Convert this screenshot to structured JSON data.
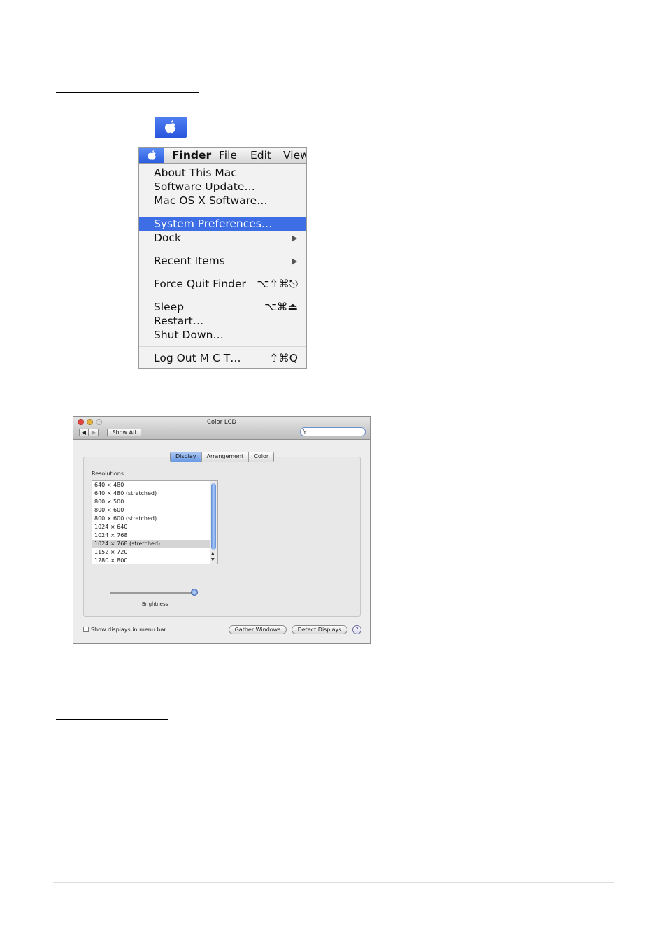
{
  "apple_menu": {
    "menubar": [
      "Finder",
      "File",
      "Edit",
      "View"
    ],
    "items": {
      "about": "About This Mac",
      "software_update": "Software Update…",
      "macosx_software": "Mac OS X Software…",
      "system_prefs": "System Preferences…",
      "dock": "Dock",
      "recent": "Recent Items",
      "force_quit": "Force Quit Finder",
      "force_quit_shortcut": "⌥⇧⌘⎋",
      "sleep": "Sleep",
      "sleep_shortcut": "⌥⌘⏏",
      "restart": "Restart…",
      "shutdown": "Shut Down…",
      "logout": "Log Out M C T…",
      "logout_shortcut": "⇧⌘Q"
    }
  },
  "display_window": {
    "title": "Color LCD",
    "show_all": "Show All",
    "tabs": [
      "Display",
      "Arrangement",
      "Color"
    ],
    "resolutions_label": "Resolutions:",
    "resolutions": [
      "640 × 480",
      "640 × 480 (stretched)",
      "800 × 500",
      "800 × 600",
      "800 × 600 (stretched)",
      "1024 × 640",
      "1024 × 768",
      "1024 × 768 (stretched)",
      "1152 × 720",
      "1280 × 800"
    ],
    "selected_resolution_index": 7,
    "brightness_label": "Brightness",
    "brightness_level": 0.97,
    "show_displays_label": "Show displays in menu bar",
    "show_displays_checked": false,
    "gather_windows": "Gather Windows",
    "detect_displays": "Detect Displays",
    "help": "?"
  },
  "colors": {
    "menu_highlight": "#3d6ee6",
    "apple_tile": "#3a66e6"
  }
}
